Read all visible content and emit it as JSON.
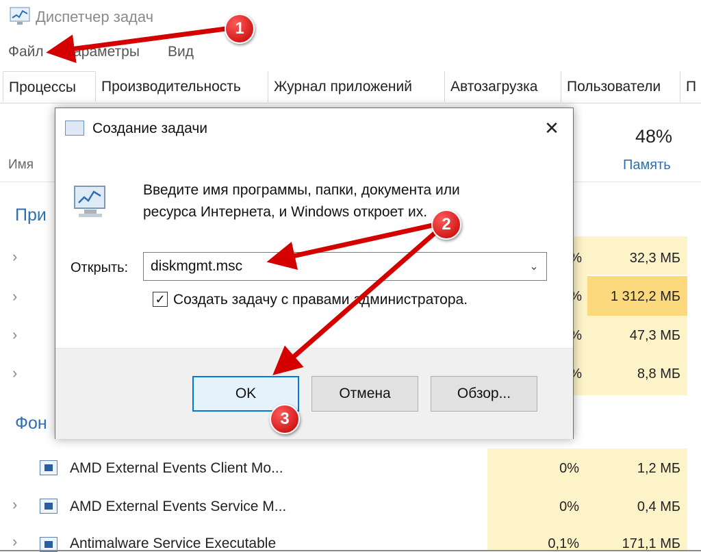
{
  "task_manager": {
    "title": "Диспетчер задач",
    "menu": [
      "Файл",
      "Параметры",
      "Вид"
    ],
    "tabs": [
      "Процессы",
      "Производительность",
      "Журнал приложений",
      "Автозагрузка",
      "Пользователи",
      "П"
    ],
    "columns": {
      "name": "Имя",
      "memory_percent": "48%",
      "memory": "Память"
    },
    "groups": {
      "apps_partial": "При",
      "background_partial": "Фон"
    },
    "app_rows": [
      {
        "cpu": "%",
        "memory": "32,3 МБ"
      },
      {
        "cpu": "%",
        "memory": "1 312,2 МБ"
      },
      {
        "cpu": "%",
        "memory": "47,3 МБ"
      },
      {
        "cpu": "%",
        "memory": "8,8 МБ"
      }
    ],
    "background_rows": [
      {
        "name": "AMD External Events Client Mo...",
        "cpu": "0%",
        "memory": "1,2 МБ"
      },
      {
        "name": "AMD External Events Service M...",
        "cpu": "0%",
        "memory": "0,4 МБ"
      },
      {
        "name": "Antimalware Service Executable",
        "cpu": "0,1%",
        "memory": "171,1 МБ"
      }
    ]
  },
  "dialog": {
    "title": "Создание задачи",
    "description_line1": "Введите имя программы, папки, документа или",
    "description_line2": "ресурса Интернета, и Windows откроет их.",
    "open_label": "Открыть:",
    "open_value": "diskmgmt.msc",
    "admin_checkbox_label": "Создать задачу с правами администратора.",
    "admin_checked": true,
    "buttons": {
      "ok": "OK",
      "cancel": "Отмена",
      "browse": "Обзор..."
    }
  },
  "annotations": {
    "step1": "1",
    "step2": "2",
    "step3": "3",
    "color": "#d40000"
  }
}
